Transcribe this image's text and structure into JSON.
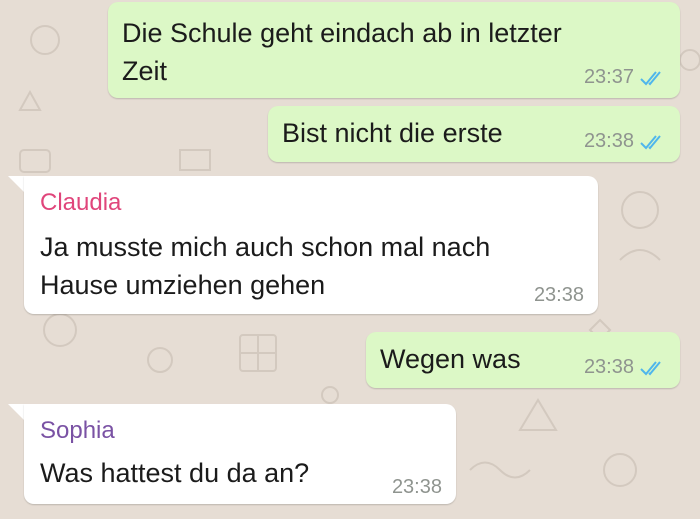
{
  "chat": {
    "messages": [
      {
        "direction": "out",
        "text": "Die Schule geht eindach ab in letzter\nZeit",
        "time": "23:37",
        "read": true
      },
      {
        "direction": "out",
        "text": "Bist nicht die erste",
        "time": "23:38",
        "read": true
      },
      {
        "direction": "in",
        "sender": "Claudia",
        "sender_color": "#e0457b",
        "text": "Ja musste mich auch schon mal nach\nHause umziehen gehen",
        "time": "23:38"
      },
      {
        "direction": "out",
        "text": "Wegen was",
        "time": "23:38",
        "read": true
      },
      {
        "direction": "in",
        "sender": "Sophia",
        "sender_color": "#7a52a4",
        "text": "Was hattest du da an?",
        "time": "23:38"
      }
    ]
  },
  "colors": {
    "outgoing_bubble": "#dcf8c6",
    "incoming_bubble": "#ffffff",
    "read_ticks": "#4fb6ec",
    "wallpaper": "#e6ddd4"
  }
}
